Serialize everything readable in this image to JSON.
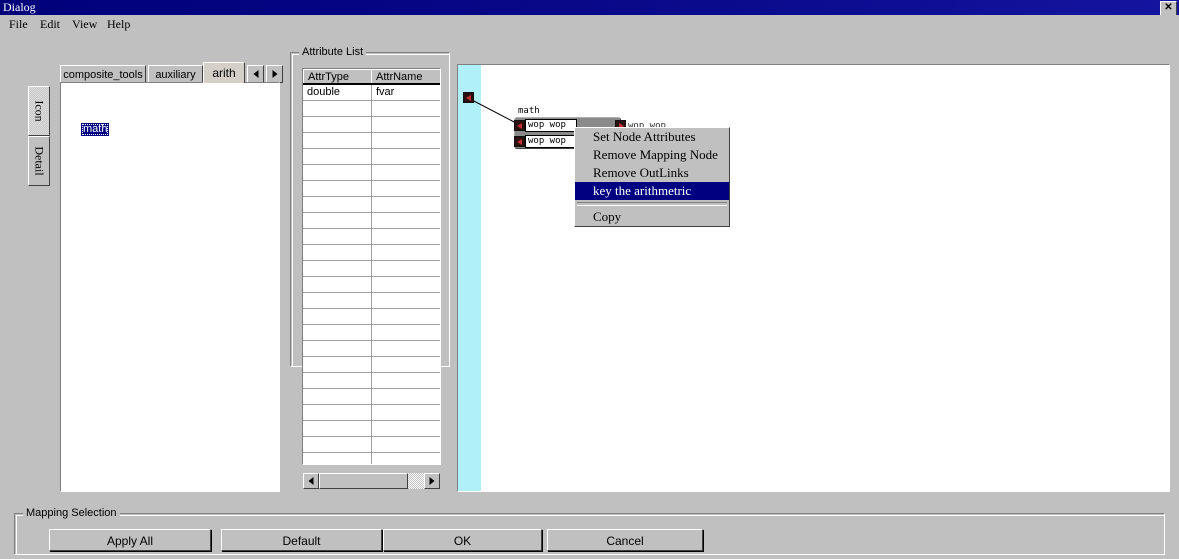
{
  "window": {
    "title": "Dialog",
    "close_label": "✕"
  },
  "menubar": {
    "items": [
      {
        "label": "File"
      },
      {
        "label": "Edit"
      },
      {
        "label": "View"
      },
      {
        "label": "Help"
      }
    ]
  },
  "left_panel": {
    "vertical_tabs": [
      {
        "label": "Icon",
        "selected": true
      },
      {
        "label": "Detail",
        "selected": false
      }
    ],
    "tabs": [
      {
        "label": "composite_tools",
        "selected": false
      },
      {
        "label": "auxiliary",
        "selected": false
      },
      {
        "label": "arith",
        "selected": true
      }
    ],
    "tab_scroll_left": "◀",
    "tab_scroll_right": "▶",
    "items": [
      {
        "label": "math",
        "selected": true
      }
    ]
  },
  "attribute_list": {
    "title": "Attribute List",
    "columns": [
      "AttrType",
      "AttrName"
    ],
    "rows": [
      [
        "double",
        "fvar"
      ]
    ],
    "empty_row_count": 23,
    "scroll_left": "◀",
    "scroll_right": "▶"
  },
  "canvas": {
    "strip_color": "#b0f0f8",
    "source_port": {
      "name": "source-port"
    },
    "node": {
      "title": "math",
      "inputs": [
        "wop wop",
        "wop wop"
      ],
      "outputs": [
        "wop wop"
      ]
    }
  },
  "context_menu": {
    "items": [
      {
        "label": "Set Node Attributes",
        "highlighted": false,
        "separator_after": false
      },
      {
        "label": "Remove Mapping Node",
        "highlighted": false,
        "separator_after": false
      },
      {
        "label": "Remove OutLinks",
        "highlighted": false,
        "separator_after": false
      },
      {
        "label": "key the arithmetric",
        "highlighted": true,
        "separator_after": true
      },
      {
        "label": "Copy",
        "highlighted": false,
        "separator_after": false
      }
    ]
  },
  "mapping_selection": {
    "title": "Mapping Selection",
    "buttons": [
      {
        "label": "Apply All"
      },
      {
        "label": "Default"
      },
      {
        "label": "OK"
      },
      {
        "label": "Cancel"
      }
    ]
  },
  "colors": {
    "titlebar": "#00007b",
    "face": "#c0c0c0",
    "highlight": "#000080",
    "canvas_strip": "#b0f0f8",
    "node_body": "#8a8a8a"
  }
}
